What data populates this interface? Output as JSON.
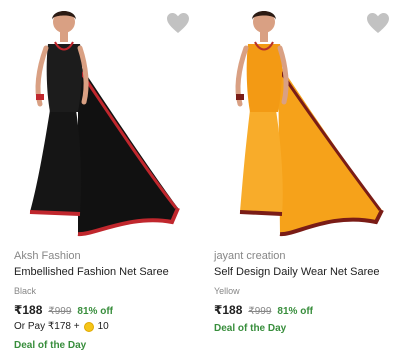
{
  "products": [
    {
      "brand": "Aksh Fashion",
      "title": "Embellished Fashion Net Saree",
      "color": "Black",
      "price": "₹188",
      "mrp": "₹999",
      "discount": "81% off",
      "pay_offer": {
        "prefix": "Or Pay ₹178 +",
        "coins": "10"
      },
      "deal_label": "Deal of the Day",
      "saree_color": "#111111",
      "border_color": "#c0272d",
      "wishlisted": false
    },
    {
      "brand": "jayant creation",
      "title": "Self Design Daily Wear Net Saree",
      "color": "Yellow",
      "price": "₹188",
      "mrp": "₹999",
      "discount": "81% off",
      "deal_label": "Deal of the Day",
      "saree_color": "#f6a21a",
      "border_color": "#7a1c16",
      "wishlisted": false
    }
  ],
  "colors": {
    "discount_green": "#388e3c",
    "muted_text": "#878787",
    "primary_text": "#212121",
    "wishlist_heart": "#c2c2c2"
  },
  "icons": {
    "wishlist": "heart-icon",
    "coin": "supercoin-icon"
  }
}
